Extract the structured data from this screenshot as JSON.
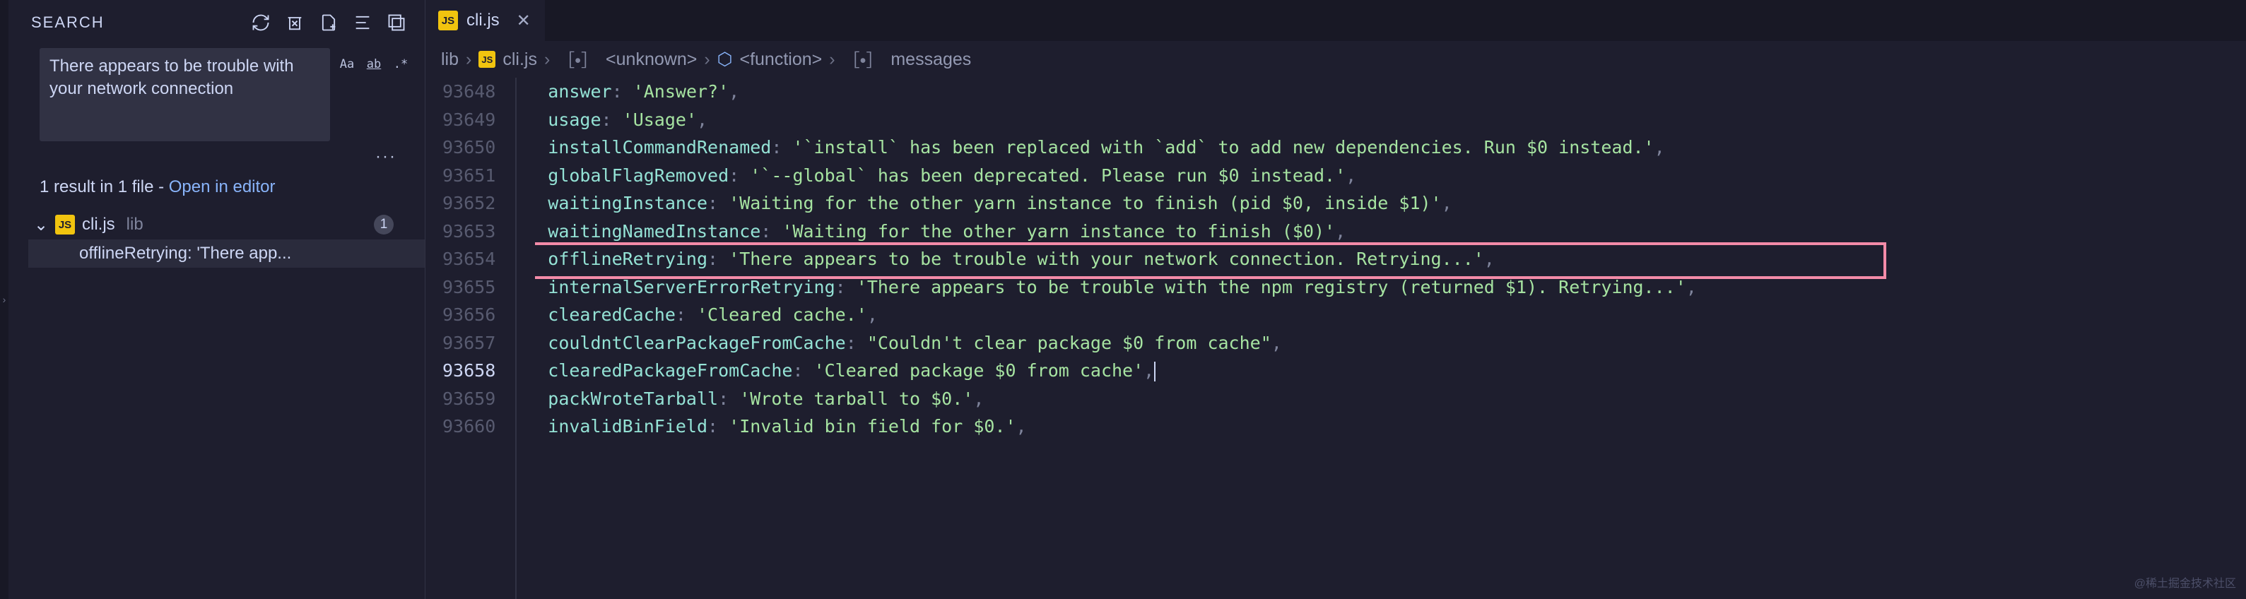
{
  "sidebar": {
    "title": "SEARCH",
    "query": "There appears to be trouble with your network connection",
    "options": {
      "case": "Aa",
      "word": "ab",
      "regex": ".*"
    },
    "summary_prefix": "1 result in 1 file - ",
    "open_link": "Open in editor",
    "file": {
      "name": "cli.js",
      "dir": "lib",
      "count": "1",
      "match": "offlineRetrying: 'There app..."
    }
  },
  "tab": {
    "name": "cli.js",
    "icon": "JS"
  },
  "breadcrumbs": {
    "seg_lib": "lib",
    "seg_file": "cli.js",
    "seg_unknown": "<unknown>",
    "seg_func": "<function>",
    "seg_msgs": "messages"
  },
  "lines": [
    {
      "n": "93648",
      "prop": "answer",
      "str": "'Answer?'"
    },
    {
      "n": "93649",
      "prop": "usage",
      "str": "'Usage'"
    },
    {
      "n": "93650",
      "prop": "installCommandRenamed",
      "str": "'`install` has been replaced with `add` to add new dependencies. Run $0 instead.'"
    },
    {
      "n": "93651",
      "prop": "globalFlagRemoved",
      "str": "'`--global` has been deprecated. Please run $0 instead.'"
    },
    {
      "n": "93652",
      "prop": "waitingInstance",
      "str": "'Waiting for the other yarn instance to finish (pid $0, inside $1)'"
    },
    {
      "n": "93653",
      "prop": "waitingNamedInstance",
      "str": "'Waiting for the other yarn instance to finish ($0)'"
    },
    {
      "n": "93654",
      "prop": "offlineRetrying",
      "str": "'There appears to be trouble with your network connection. Retrying...'",
      "hl": true
    },
    {
      "n": "93655",
      "prop": "internalServerErrorRetrying",
      "str": "'There appears to be trouble with the npm registry (returned $1). Retrying...'"
    },
    {
      "n": "93656",
      "prop": "clearedCache",
      "str": "'Cleared cache.'"
    },
    {
      "n": "93657",
      "prop": "couldntClearPackageFromCache",
      "str": "\"Couldn't clear package $0 from cache\""
    },
    {
      "n": "93658",
      "prop": "clearedPackageFromCache",
      "str": "'Cleared package $0 from cache'",
      "current": true,
      "cursor": true
    },
    {
      "n": "93659",
      "prop": "packWroteTarball",
      "str": "'Wrote tarball to $0.'"
    },
    {
      "n": "93660",
      "prop": "invalidBinField",
      "str": "'Invalid bin field for $0.'"
    }
  ],
  "watermark": "@稀土掘金技术社区"
}
